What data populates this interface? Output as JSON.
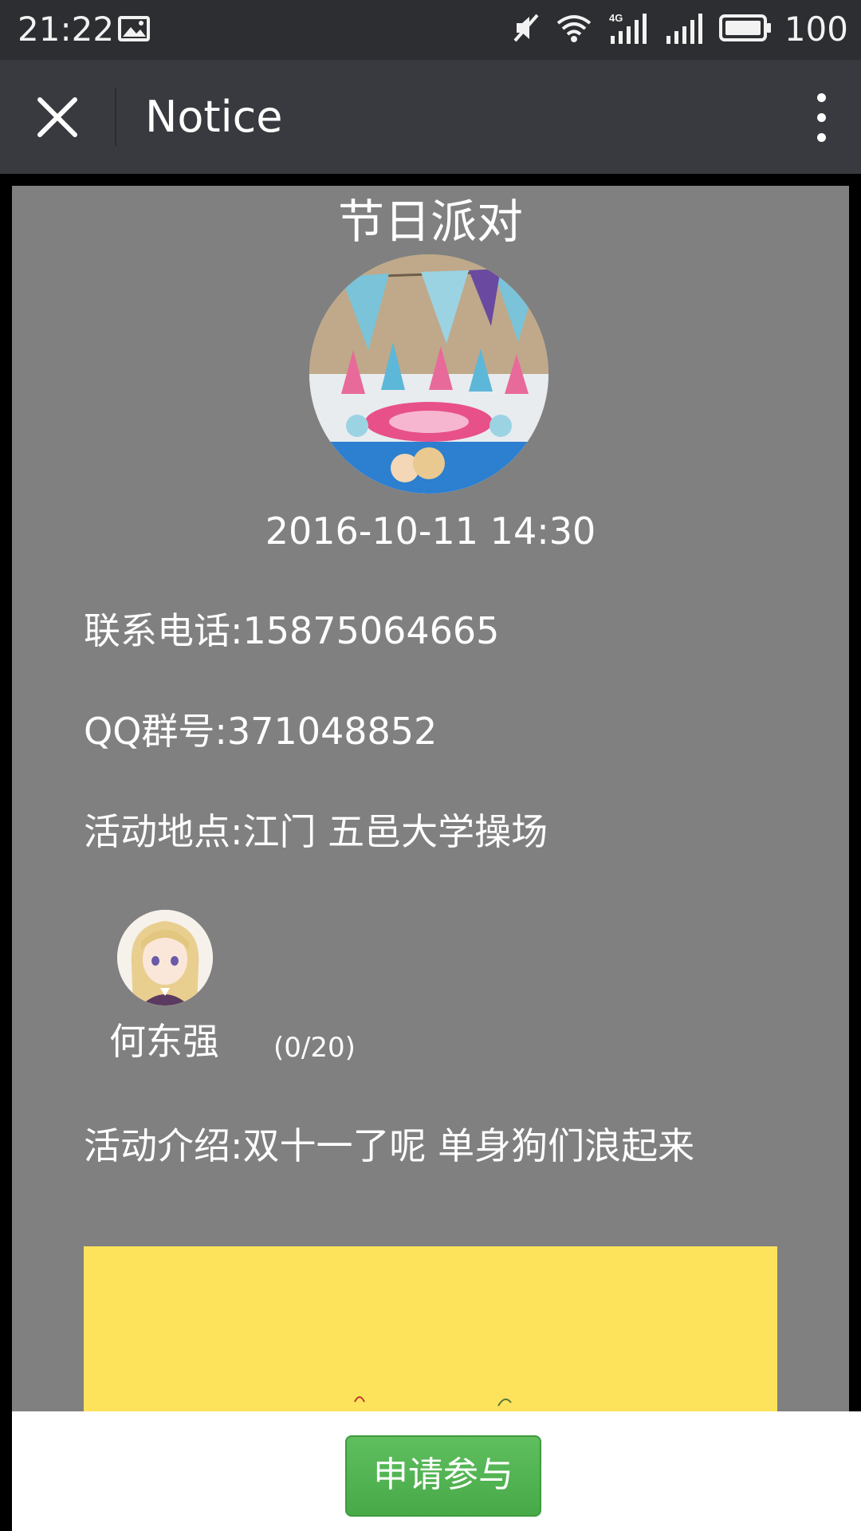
{
  "status_bar": {
    "time": "21:22",
    "network_type": "4G",
    "battery_level": "100",
    "icons": [
      "image-icon",
      "mute-icon",
      "wifi-icon",
      "signal-4g-icon",
      "signal-icon",
      "battery-icon"
    ]
  },
  "app_bar": {
    "title": "Notice",
    "close_icon": "close-icon",
    "menu_icon": "more-vertical-icon",
    "background": "#393a3f"
  },
  "event": {
    "title": "节日派对",
    "datetime": "2016-10-11 14:30",
    "phone": "联系电话:15875064665",
    "qq_group": "QQ群号:371048852",
    "location": "活动地点:江门 五邑大学操场",
    "organizer": {
      "name": "何东强",
      "participants": "(0/20)"
    },
    "intro": "活动介绍:双十一了呢 单身狗们浪起来",
    "content_background": "#808080",
    "intro_image_color": "#fde35b"
  },
  "actions": {
    "apply_label": "申请参与",
    "apply_color": "#4fb24f"
  }
}
